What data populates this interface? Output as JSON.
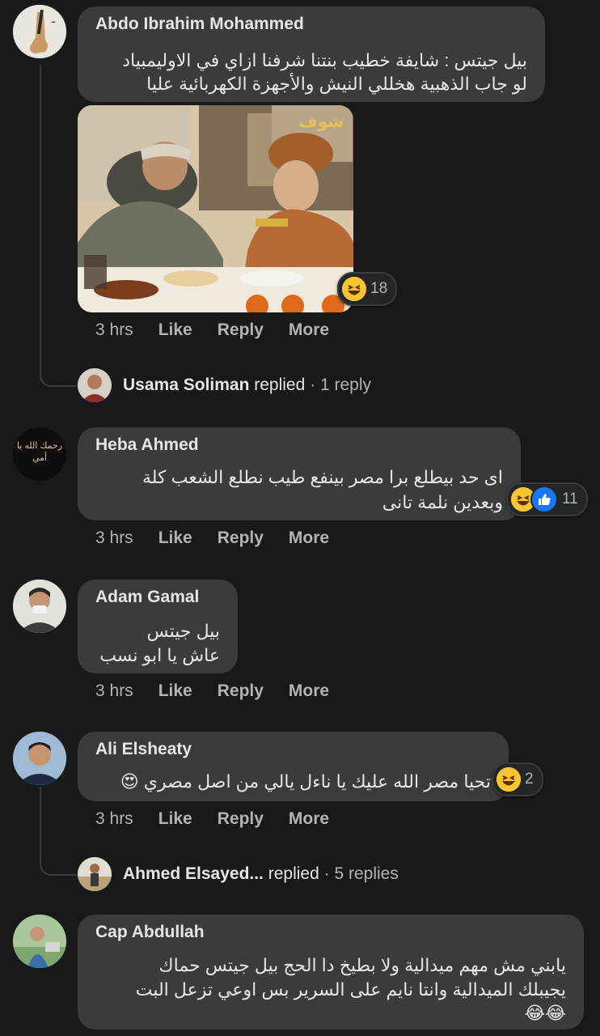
{
  "comments": [
    {
      "author": "Abdo Ibrahim Mohammed",
      "line1": "بيل جيتس : شايفة خطيب بنتنا شرفنا ازاي في الاوليمبياد",
      "line2": "لو جاب الذهبية هخللي النيش والأجهزة الكهربائية عليا",
      "image_watermark": "شوف",
      "reaction_count": "18",
      "reaction_icons": [
        "haha-icon"
      ],
      "time": "3 hrs"
    },
    {
      "author": "Heba Ahmed",
      "line1": "اى حد بيطلع برا مصر بينفع طيب نطلع الشعب كلة",
      "line2": "وبعدين نلمة تانى",
      "avatar_text": "رحمك الله يا أمي",
      "reaction_count": "11",
      "reaction_icons": [
        "haha-icon",
        "like-icon"
      ],
      "time": "3 hrs"
    },
    {
      "author": "Adam Gamal",
      "line1": "بيل جيتس",
      "line2": "عاش يا ابو نسب",
      "time": "3 hrs"
    },
    {
      "author": "Ali Elsheaty",
      "line1": "تحيا مصر الله عليك يا ناءل يالي من اصل مصري 😍",
      "reaction_count": "2",
      "reaction_icons": [
        "haha-icon"
      ],
      "time": "3 hrs"
    },
    {
      "author": "Cap Abdullah",
      "line1": "يابني مش مهم ميدالية ولا بطيخ دا الحج بيل جيتس حماك",
      "line2": "يجيبلك الميدالية وانتا نايم على السرير بس اوعي تزعل البت",
      "line3": "😂😂"
    }
  ],
  "actions": {
    "like": "Like",
    "reply": "Reply",
    "more": "More"
  },
  "reply_previews": [
    {
      "name": "Usama Soliman",
      "verb": "replied",
      "count": "· 1 reply"
    },
    {
      "name": "Ahmed Elsayed...",
      "verb": "replied",
      "count": "· 5 replies"
    }
  ],
  "colors": {
    "background": "#18191a",
    "bubble": "#3a3b3c",
    "text": "#e4e6eb",
    "secondary": "#b0b3b8",
    "like_blue": "#1877f2",
    "haha_yellow": "#f7c531"
  }
}
